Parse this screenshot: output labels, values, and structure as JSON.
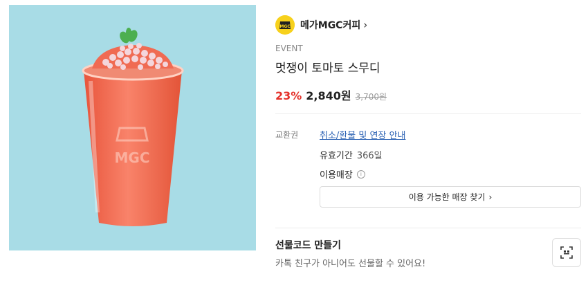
{
  "brand": {
    "name": "메가MGC커피",
    "logo_text": "MGC"
  },
  "product": {
    "event_tag": "EVENT",
    "title": "멋쟁이 토마토 스무디",
    "image_cup_text": "MGC",
    "discount": "23%",
    "sale_price": "2,840원",
    "original_price": "3,700원"
  },
  "voucher": {
    "label": "교환권",
    "refund_link": "취소/환불 및 연장 안내",
    "validity_label": "유효기간",
    "validity_value": "366일",
    "store_label": "이용매장",
    "info_icon": "i",
    "find_store_button": "이용 가능한 매장 찾기"
  },
  "gift": {
    "title": "선물코드 만들기",
    "subtitle": "카톡 친구가 아니어도 선물할 수 있어요!"
  },
  "icons": {
    "brand_chevron": "›",
    "find_chevron": "›"
  },
  "colors": {
    "image_background": "#a8dce6",
    "discount": "#e4322b",
    "link": "#2b62b4",
    "brand_logo": "#f7d11c"
  }
}
